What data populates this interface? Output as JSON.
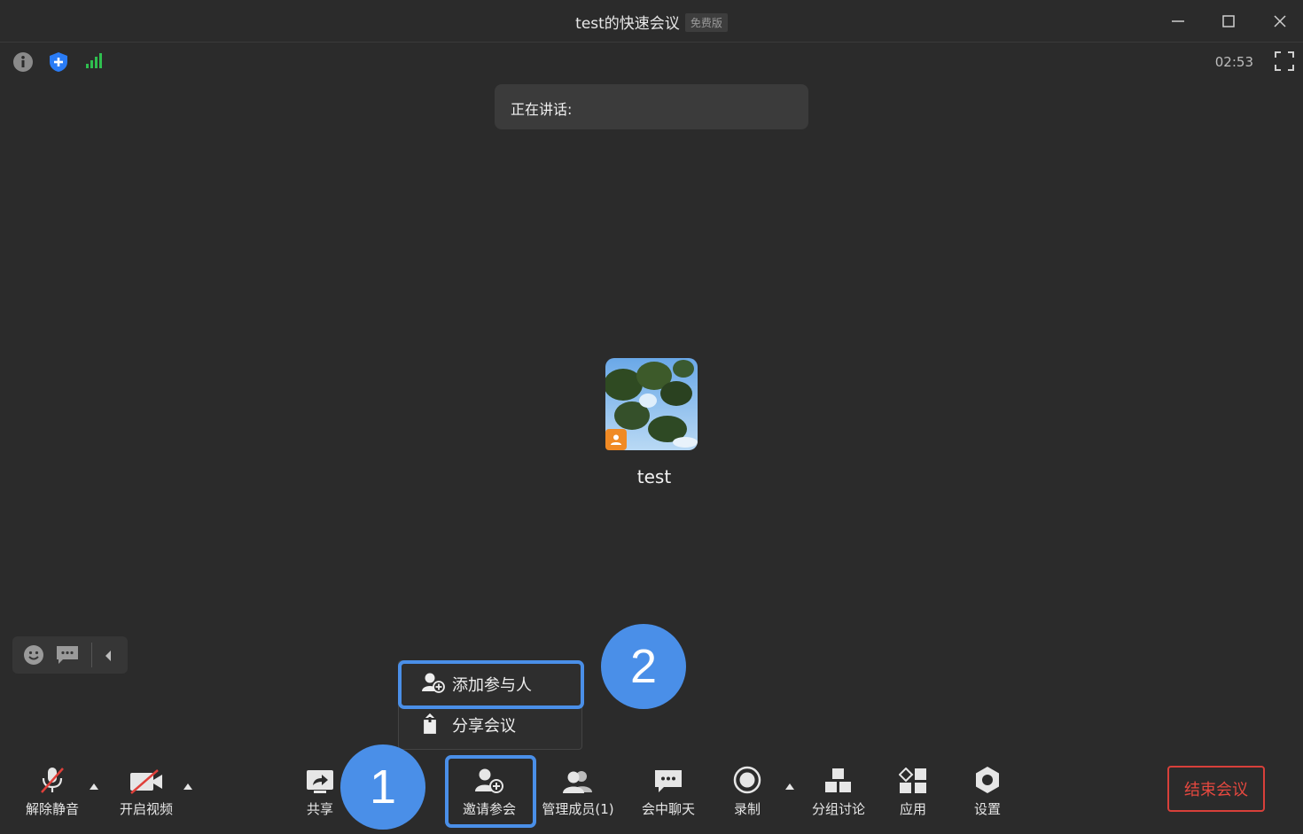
{
  "window": {
    "title": "test的快速会议",
    "edition_badge": "免费版"
  },
  "status": {
    "timer": "02:53"
  },
  "speaking_panel": {
    "label": "正在讲话:"
  },
  "participant": {
    "name": "test"
  },
  "invite_menu": {
    "items": [
      {
        "label": "添加参与人",
        "icon": "add-person-icon"
      },
      {
        "label": "分享会议",
        "icon": "share-upload-icon"
      }
    ]
  },
  "annotations": {
    "step1": "1",
    "step2": "2"
  },
  "toolbar": {
    "unmute": "解除静音",
    "start_video": "开启视频",
    "share": "共享",
    "invite": "邀请参会",
    "manage_members": "管理成员(1)",
    "chat": "会中聊天",
    "record": "录制",
    "breakout": "分组讨论",
    "apps": "应用",
    "settings": "设置",
    "end_meeting": "结束会议"
  },
  "colors": {
    "background": "#2b2b2b",
    "accent_blue": "#4a8fe8",
    "end_red": "#e5483f",
    "signal_green": "#2fbf4f",
    "shield_blue": "#2a7cf6"
  }
}
